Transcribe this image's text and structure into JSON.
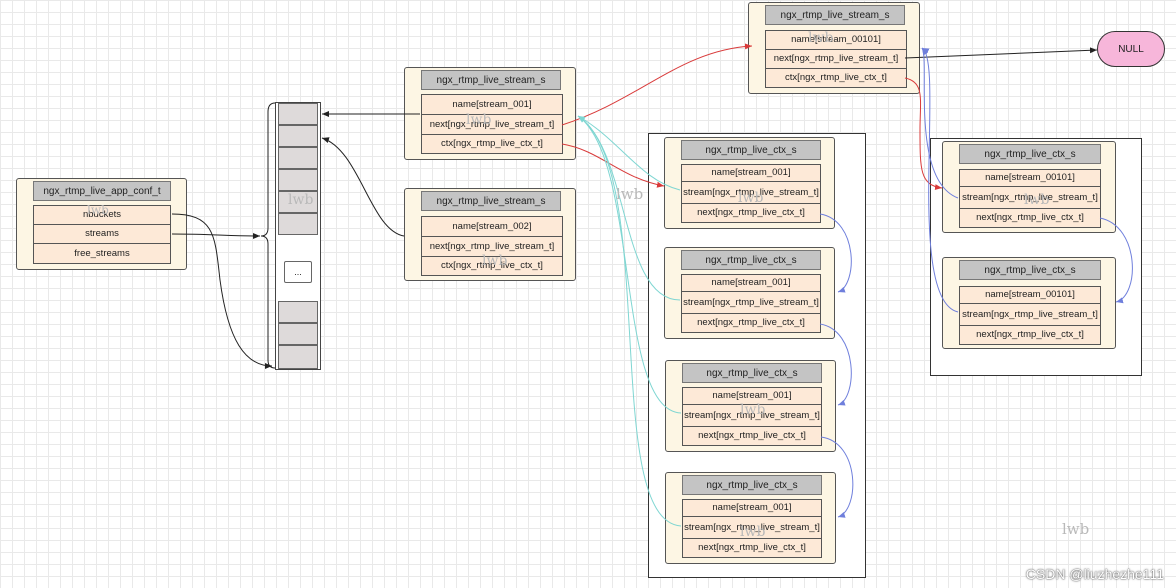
{
  "app_conf": {
    "title": "ngx_rtmp_live_app_conf_t",
    "fields": [
      "nbuckets",
      "streams",
      "free_streams"
    ]
  },
  "hash_table": {
    "ellipsis": "..."
  },
  "stream_001": {
    "title": "ngx_rtmp_live_stream_s",
    "fields": [
      "name[stream_001]",
      "next[ngx_rtmp_live_stream_t]",
      "ctx[ngx_rtmp_live_ctx_t]"
    ]
  },
  "stream_002": {
    "title": "ngx_rtmp_live_stream_s",
    "fields": [
      "name[stream_002]",
      "next[ngx_rtmp_live_stream_t]",
      "ctx[ngx_rtmp_live_ctx_t]"
    ]
  },
  "stream_00101": {
    "title": "ngx_rtmp_live_stream_s",
    "fields": [
      "name[stream_00101]",
      "next[ngx_rtmp_live_stream_t]",
      "ctx[ngx_rtmp_live_ctx_t]"
    ]
  },
  "null_node": {
    "label": "NULL"
  },
  "ctx_group_001": [
    {
      "title": "ngx_rtmp_live_ctx_s",
      "fields": [
        "name[stream_001]",
        "stream[ngx_rtmp_live_stream_t]",
        "next[ngx_rtmp_live_ctx_t]"
      ]
    },
    {
      "title": "ngx_rtmp_live_ctx_s",
      "fields": [
        "name[stream_001]",
        "stream[ngx_rtmp_live_stream_t]",
        "next[ngx_rtmp_live_ctx_t]"
      ]
    },
    {
      "title": "ngx_rtmp_live_ctx_s",
      "fields": [
        "name[stream_001]",
        "stream[ngx_rtmp_live_stream_t]",
        "next[ngx_rtmp_live_ctx_t]"
      ]
    },
    {
      "title": "ngx_rtmp_live_ctx_s",
      "fields": [
        "name[stream_001]",
        "stream[ngx_rtmp_live_stream_t]",
        "next[ngx_rtmp_live_ctx_t]"
      ]
    }
  ],
  "ctx_group_00101": [
    {
      "title": "ngx_rtmp_live_ctx_s",
      "fields": [
        "name[stream_00101]",
        "stream[ngx_rtmp_live_stream_t]",
        "next[ngx_rtmp_live_ctx_t]"
      ]
    },
    {
      "title": "ngx_rtmp_live_ctx_s",
      "fields": [
        "name[stream_00101]",
        "stream[ngx_rtmp_live_stream_t]",
        "next[ngx_rtmp_live_ctx_t]"
      ]
    }
  ],
  "watermark": "lwb",
  "credit": "CSDN @liuzhezhe111",
  "colors": {
    "black_link": "#222222",
    "red_link": "#d93a3a",
    "cyan_link": "#7fd6d2",
    "blue_link": "#6f7fdc"
  }
}
